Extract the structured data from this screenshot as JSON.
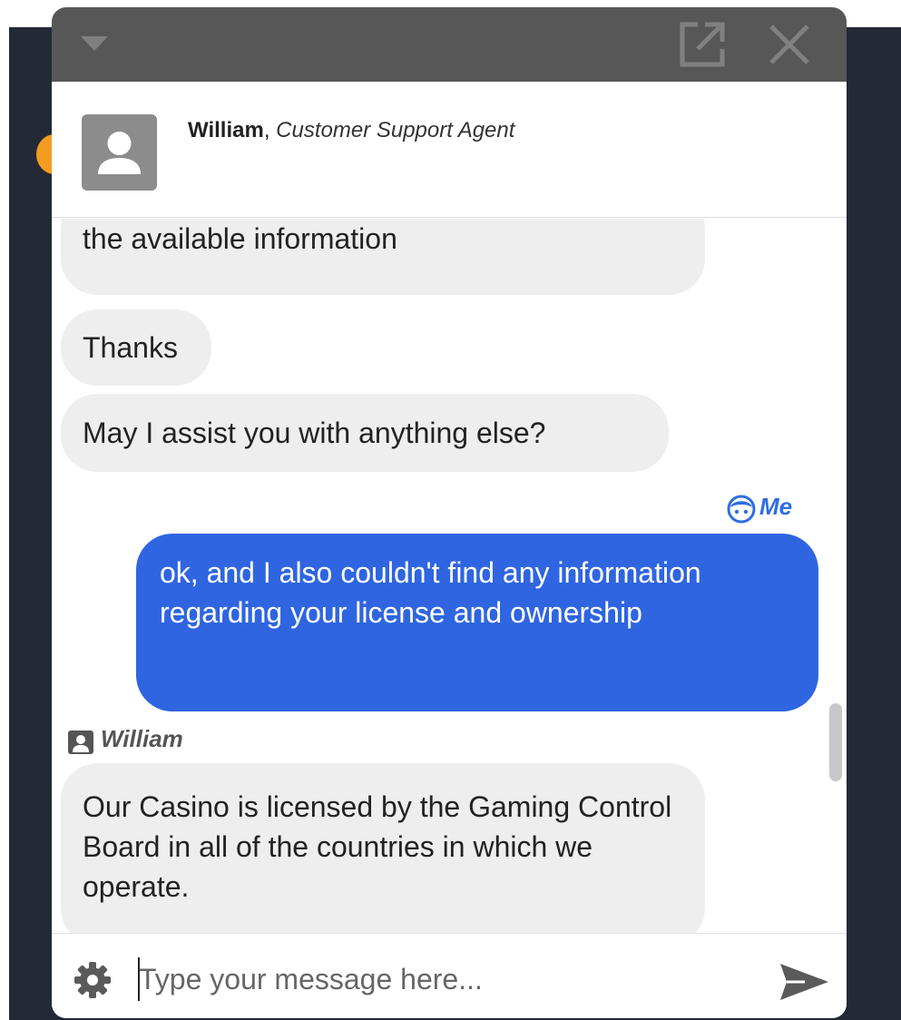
{
  "header": {
    "agent_name": "William",
    "agent_separator": ",",
    "agent_role": "Customer Support Agent"
  },
  "messages": [
    {
      "from": "agent",
      "text": "the available information"
    },
    {
      "from": "agent",
      "text": "Thanks"
    },
    {
      "from": "agent",
      "text": "May I assist you with anything else?"
    },
    {
      "from": "me",
      "sender_label": "Me",
      "text": "ok, and I also couldn't find any information regarding your license and ownership"
    },
    {
      "from": "agent",
      "sender_label": "William",
      "text": "Our Casino is licensed by the Gaming Control Board in all of the countries in which we operate."
    }
  ],
  "composer": {
    "placeholder": "Type your message here...",
    "value": ""
  },
  "colors": {
    "titlebar": "#575757",
    "my_bubble": "#2f65e0",
    "agent_bubble": "#eeeeee",
    "me_label": "#2f6ee0"
  },
  "icons": [
    "collapse-icon",
    "popout-icon",
    "close-icon",
    "user-avatar-icon",
    "me-face-icon",
    "agent-id-icon",
    "gear-icon",
    "send-icon"
  ]
}
